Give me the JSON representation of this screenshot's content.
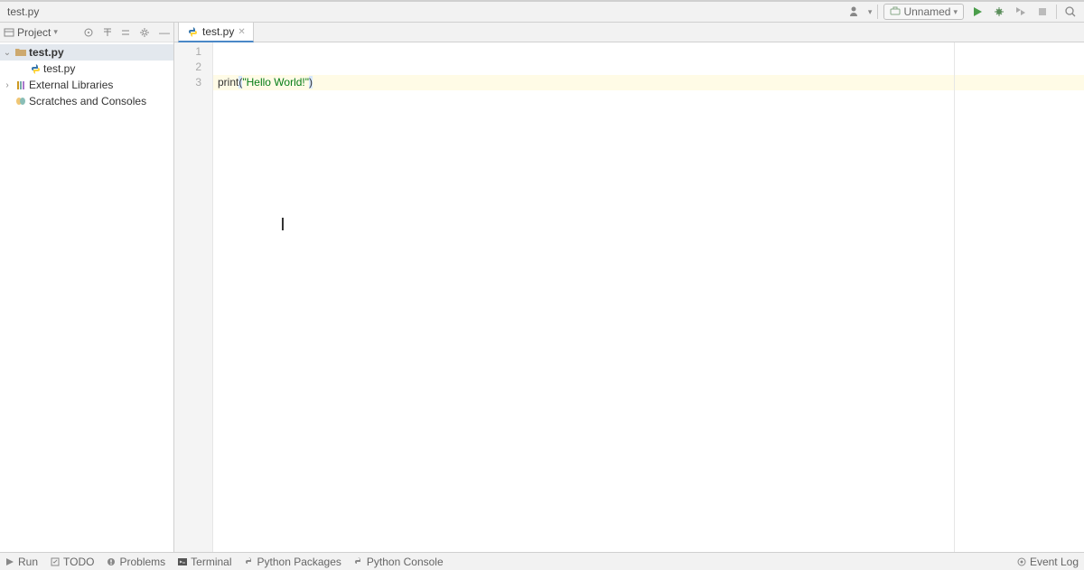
{
  "breadcrumb": "test.py",
  "run_config": "Unnamed",
  "sidebar": {
    "title": "Project",
    "nodes": {
      "root": "test.py",
      "file": "test.py",
      "ext_libs": "External Libraries",
      "scratches": "Scratches and Consoles"
    }
  },
  "editor": {
    "tab_name": "test.py",
    "gutter": [
      "1",
      "2",
      "3"
    ],
    "line3": {
      "fn": "print",
      "lp": "(",
      "str": "\"Hello World!\"",
      "rp": ")"
    }
  },
  "bottom": {
    "run": "Run",
    "todo": "TODO",
    "problems": "Problems",
    "terminal": "Terminal",
    "pypkg": "Python Packages",
    "pycon": "Python Console",
    "event_log": "Event Log"
  }
}
